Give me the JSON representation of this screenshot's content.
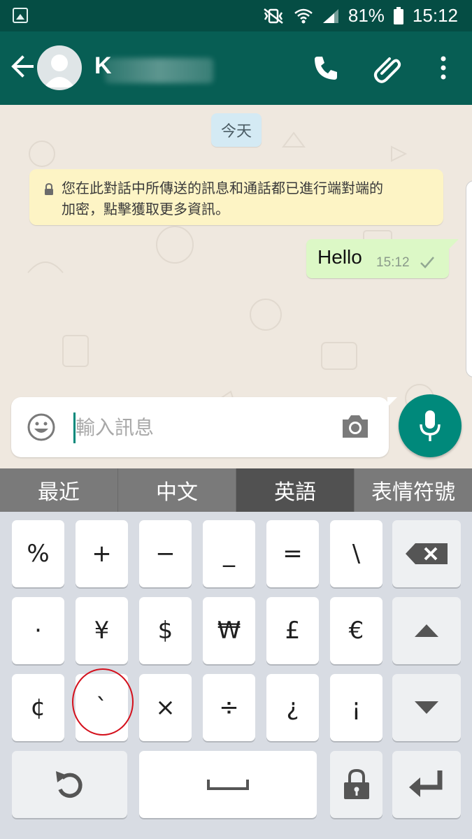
{
  "status_bar": {
    "battery": "81%",
    "time": "15:12"
  },
  "header": {
    "contact_initial": "K"
  },
  "chat": {
    "date_chip": "今天",
    "e2e_notice_line1": "您在此對話中所傳送的訊息和通話都已進行端對端的",
    "e2e_notice_line2": "加密，點擊獲取更多資訊。",
    "messages": [
      {
        "text": "Hello",
        "time": "15:12",
        "status": "sent"
      }
    ]
  },
  "composer": {
    "placeholder": "輸入訊息"
  },
  "keyboard": {
    "tabs": [
      "最近",
      "中文",
      "英語",
      "表情符號"
    ],
    "active_tab": "英語",
    "row1": [
      "%",
      "+",
      "−",
      "_",
      "=",
      "\\"
    ],
    "row2": [
      "·",
      "¥",
      "$",
      "₩",
      "£",
      "€"
    ],
    "row3": [
      "¢",
      "`",
      "×",
      "÷",
      "¿",
      "¡"
    ],
    "space_symbol": "␣"
  },
  "colors": {
    "header": "#075e54",
    "status_bar": "#054d44",
    "accent": "#00897b",
    "bubble_out": "#dcf8c6",
    "notice": "#fdf4c5",
    "annotation": "#d4101c"
  }
}
